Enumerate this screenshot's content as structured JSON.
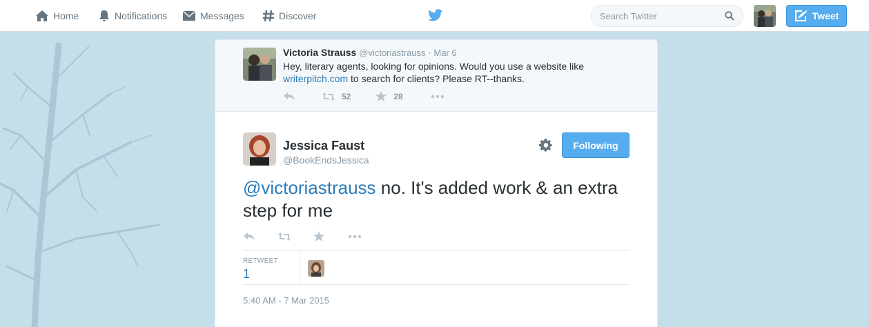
{
  "nav": {
    "home": "Home",
    "notifications": "Notifications",
    "messages": "Messages",
    "discover": "Discover",
    "search_placeholder": "Search Twitter",
    "tweet_button": "Tweet"
  },
  "ancestor_tweet": {
    "name": "Victoria Strauss",
    "handle": "@victoriastrauss",
    "date": "· Mar 6",
    "text_before_link": "Hey, literary agents, looking for opinions. Would you use a website like",
    "link": "writerpitch.com",
    "text_after_link": " to search for clients? Please RT--thanks.",
    "retweets": "52",
    "favorites": "28"
  },
  "main_tweet": {
    "name": "Jessica Faust",
    "handle": "@BookEndsJessica",
    "follow_label": "Following",
    "mention": "@victoriastrauss",
    "text": " no. It's added work & an extra step for me",
    "retweet_label": "RETWEET",
    "retweet_count": "1",
    "timestamp": "5:40 AM - 7 Mar 2015"
  },
  "colors": {
    "accent": "#55acee",
    "link": "#2b7bb9",
    "background": "#c5dfea"
  }
}
